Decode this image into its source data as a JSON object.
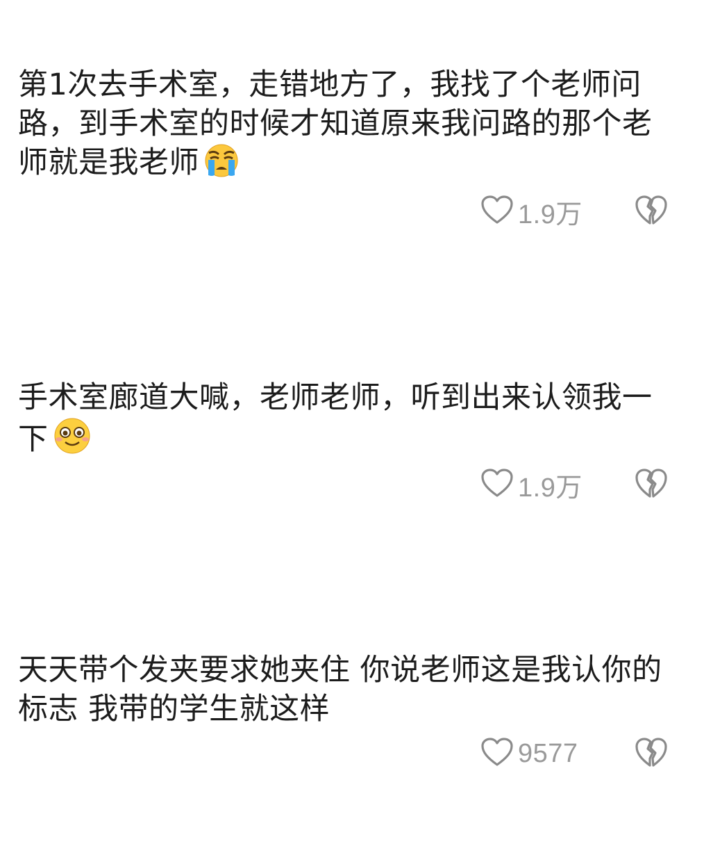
{
  "comments": [
    {
      "text": "第1次去手术室，走错地方了，我找了个老师问路，到手术室的时候才知道原来我问路的那个老师就是我老师",
      "emoji": "crying-face",
      "likes": "1.9万"
    },
    {
      "text": "手术室廊道大喊，老师老师，听到出来认领我一下",
      "emoji": "shy-smiling-face",
      "likes": "1.9万"
    },
    {
      "text": "天天带个发夹要求她夹住 你说老师这是我认你的标志 我带的学生就这样",
      "emoji": "",
      "likes": "9577"
    }
  ],
  "icons": {
    "like": "heart-outline-icon",
    "dislike": "broken-heart-icon"
  },
  "colors": {
    "text": "#1c1c1c",
    "meta": "#9a9a9a",
    "background": "#ffffff"
  }
}
